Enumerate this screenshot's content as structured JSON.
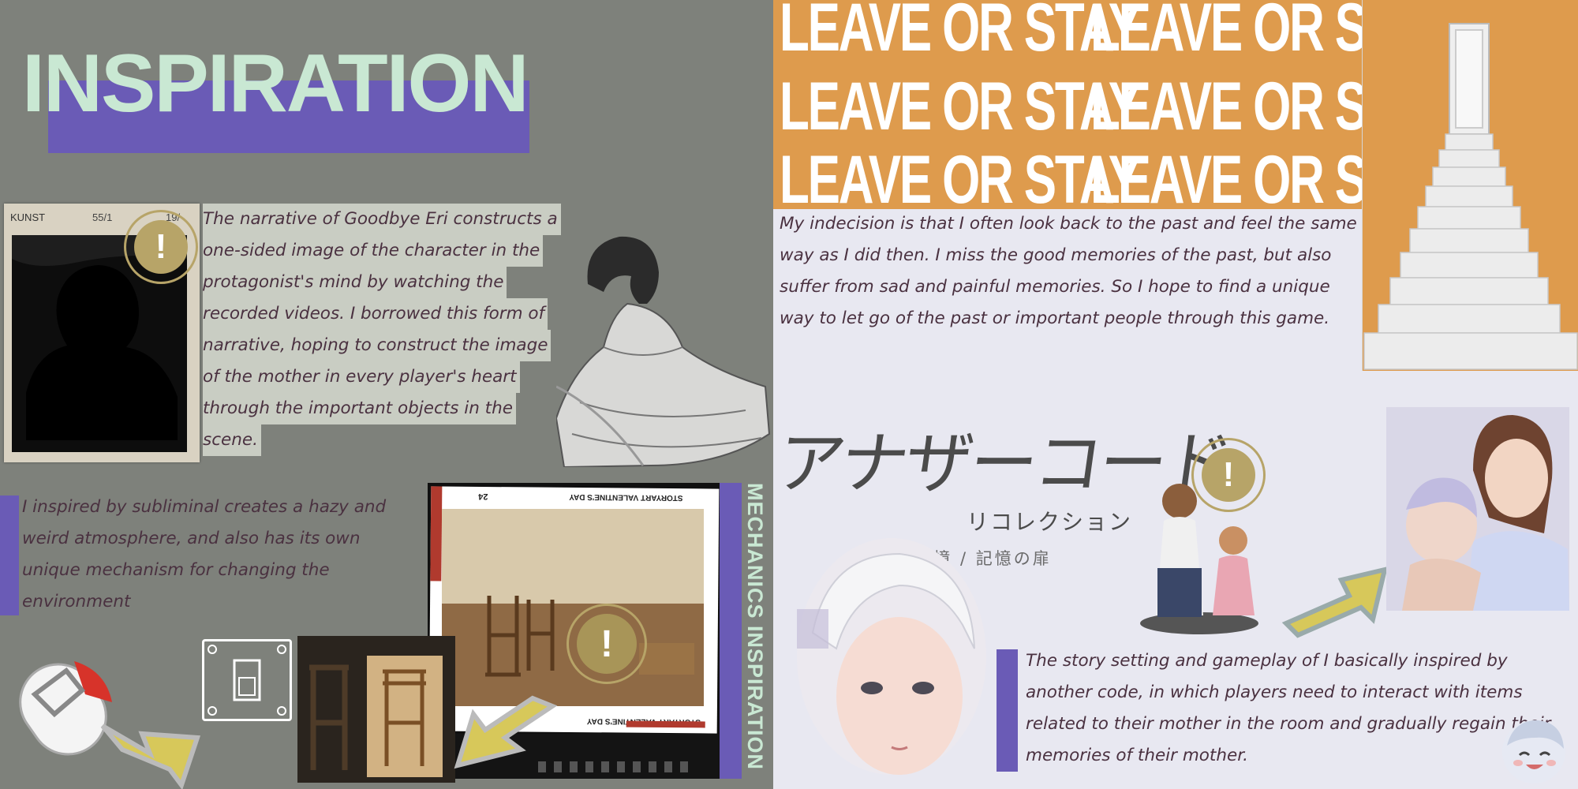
{
  "title": "INSPIRATION",
  "kunst_card": {
    "label": "KUNST",
    "num1": "55/1",
    "num2": "19/"
  },
  "paragraphs": {
    "goodbye_eri": [
      "The narrative of Goodbye Eri constructs a",
      "one-sided image of the character in the",
      "protagonist's mind by watching the",
      "recorded videos. I borrowed this form of",
      "narrative, hoping to construct the image",
      "of the mother in every player's heart",
      "through the important objects in the",
      "scene."
    ],
    "subliminal": "I inspired by subliminal creates a hazy and weird atmosphere, and also has its own unique mechanism for changing the environment",
    "indecision": "My indecision is that I often look back to the past and feel the same way as I did then. I miss the good memories of the past, but also suffer from sad and painful memories. So I hope to find a unique way to let go of the past or important people through this game.",
    "another_code": "The story setting and gameplay of I basically inspired by another code, in which players need to interact with items related to their mother in the room and gradually regain their memories of their mother."
  },
  "mechanics_label": "MECHANICS INSPIRATION",
  "polaroid_caption": "STORYART VALENTINE'S DAY",
  "polaroid_num": "24",
  "leave_or_stay": "LEAVE OR STAY",
  "jp_title": {
    "main": "アナザーコード",
    "sub": "リコレクション",
    "tagline": "2つの記憶 / 記憶の扉"
  },
  "badge_glyph": "!",
  "colors": {
    "purple": "#6a5bb6",
    "mint": "#c9e8d3",
    "orange": "#de9b4d",
    "text": "#4a3140",
    "gold": "#b7a468"
  }
}
